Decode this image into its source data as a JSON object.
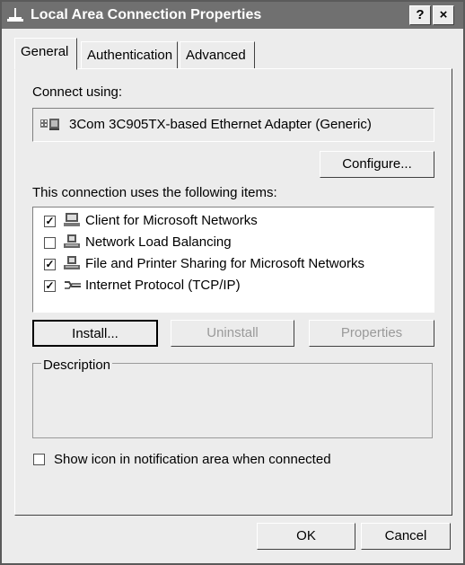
{
  "window": {
    "title": "Local Area Connection Properties",
    "help_button": "?",
    "close_button": "×"
  },
  "tabs": [
    {
      "label": "General",
      "active": true
    },
    {
      "label": "Authentication",
      "active": false
    },
    {
      "label": "Advanced",
      "active": false
    }
  ],
  "connect": {
    "label": "Connect using:",
    "adapter": "3Com 3C905TX-based Ethernet Adapter (Generic)",
    "adapter_icon": "network-card-icon"
  },
  "buttons": {
    "configure": "Configure...",
    "install": "Install...",
    "uninstall": "Uninstall",
    "properties": "Properties",
    "ok": "OK",
    "cancel": "Cancel"
  },
  "items_label": "This connection uses the following items:",
  "items": [
    {
      "label": "Client for Microsoft Networks",
      "checked": true,
      "icon": "network-client-icon"
    },
    {
      "label": "Network Load Balancing",
      "checked": false,
      "icon": "network-service-icon"
    },
    {
      "label": "File and Printer Sharing for Microsoft Networks",
      "checked": true,
      "icon": "network-service-icon"
    },
    {
      "label": "Internet Protocol (TCP/IP)",
      "checked": true,
      "icon": "protocol-icon"
    }
  ],
  "description": {
    "label": "Description",
    "text": ""
  },
  "show_icon": {
    "label": "Show icon in notification area when connected",
    "checked": false
  }
}
